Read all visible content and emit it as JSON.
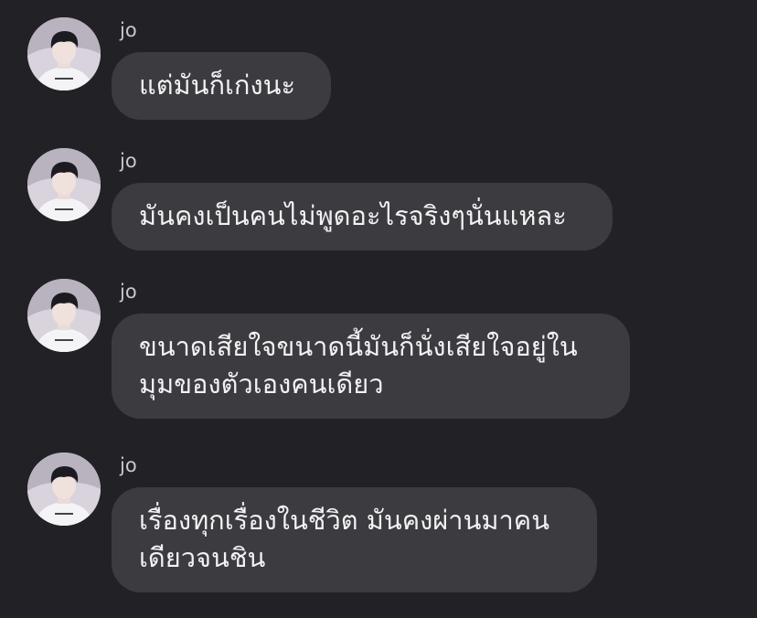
{
  "messages": [
    {
      "sender": "jo",
      "text": "แต่มันก็เก่งนะ"
    },
    {
      "sender": "jo",
      "text": "มันคงเป็นคนไม่พูดอะไรจริงๆนั่นแหละ"
    },
    {
      "sender": "jo",
      "text": "ขนาดเสียใจขนาดนี้มันก็นั่งเสียใจอยู่ใน\nมุมของตัวเองคนเดียว"
    },
    {
      "sender": "jo",
      "text": "เรื่องทุกเรื่องในชีวิต มันคงผ่านมาคน\nเดียวจนชิน"
    }
  ],
  "colors": {
    "background": "#222226",
    "bubble": "#3b3b40",
    "text": "#f2f2f4",
    "sender": "#c9c9cc"
  },
  "icons": {
    "avatar": "profile-photo"
  }
}
